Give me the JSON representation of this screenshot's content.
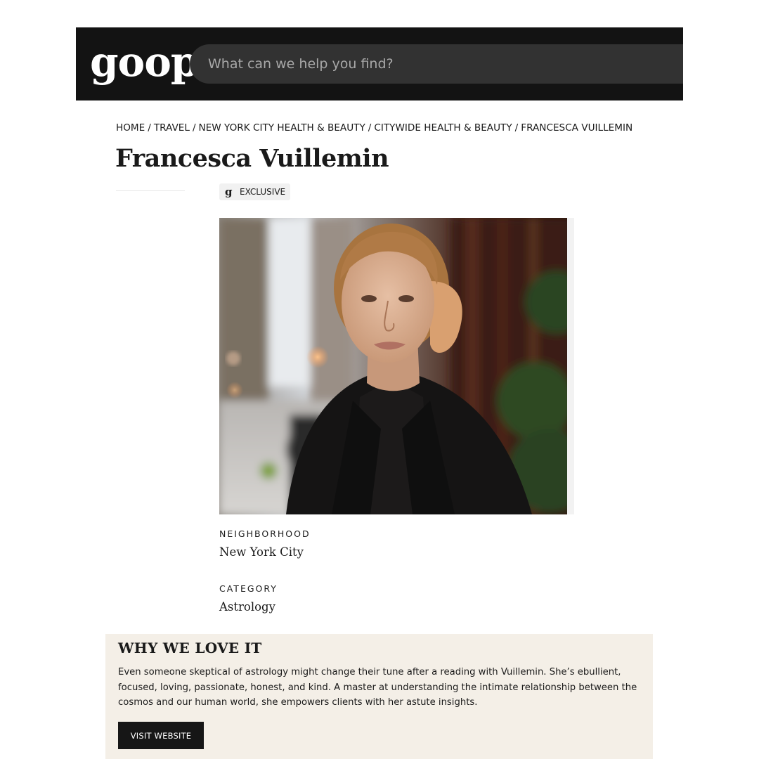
{
  "header": {
    "logo": "goop",
    "search_placeholder": "What can we help you find?"
  },
  "breadcrumb": [
    "HOME",
    "TRAVEL",
    "NEW YORK CITY HEALTH & BEAUTY",
    "CITYWIDE HEALTH & BEAUTY",
    "FRANCESCA VUILLEMIN"
  ],
  "page": {
    "title": "Francesca Vuillemin",
    "badge_icon": "g-icon",
    "badge_label": "EXCLUSIVE"
  },
  "details": {
    "neighborhood_label": "NEIGHBORHOOD",
    "neighborhood_value": "New York City",
    "category_label": "CATEGORY",
    "category_value": "Astrology"
  },
  "why_we_love_it": {
    "title": "WHY WE LOVE IT",
    "body": "Even someone skeptical of astrology might change their tune after a reading with Vuillemin. She’s ebullient, focused, loving, passionate, honest, and kind. A master at understanding the intimate relationship between the cosmos and our human world, she empowers clients with her astute insights.",
    "button_label": "VISIT WEBSITE"
  },
  "colors": {
    "header_bg": "#131313",
    "search_bg": "#323232",
    "panel_bg": "#f4efe7",
    "button_bg": "#161616"
  }
}
